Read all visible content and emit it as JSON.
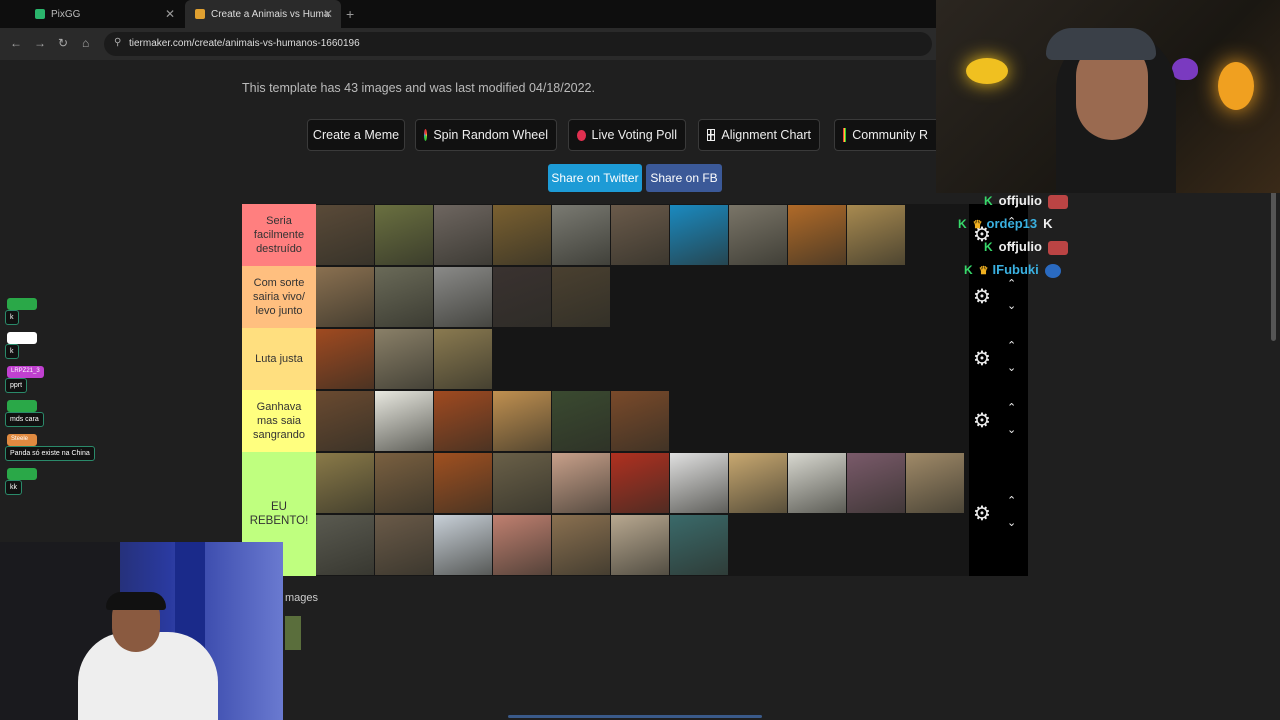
{
  "browser": {
    "tabs": [
      {
        "label": "PixGG",
        "favicon_color": "#2ab56c"
      },
      {
        "label": "Create a Animais vs Humanos T",
        "favicon_color": "#e0a030"
      }
    ],
    "new_tab": "+",
    "url": "tiermaker.com/create/animais-vs-humanos-1660196"
  },
  "page": {
    "template_info": "This template has 43 images and was last modified 04/18/2022.",
    "buttons": [
      {
        "label": "Create a Meme",
        "icon": ""
      },
      {
        "label": "Spin Random Wheel",
        "icon": "wheel-icon"
      },
      {
        "label": "Live Voting Poll",
        "icon": "record-icon"
      },
      {
        "label": "Alignment Chart",
        "icon": "grid-icon"
      },
      {
        "label": "Community R",
        "icon": "grid-colored-icon"
      }
    ],
    "share": {
      "twitter": "Share on Twitter",
      "fb": "Share on FB",
      "twitter_color": "#1d9bd6",
      "fb_color": "#3b5998"
    },
    "images_label": "mages"
  },
  "tiers": [
    {
      "label": "Seria facilmente destruído",
      "color": "#ff7f7f",
      "items": [
        {
          "name": "bear",
          "color": "#5a4a38"
        },
        {
          "name": "moose",
          "color": "#6a7040"
        },
        {
          "name": "hippo",
          "color": "#6e6660"
        },
        {
          "name": "jaguar",
          "color": "#7a6030"
        },
        {
          "name": "elephant",
          "color": "#7a7a72"
        },
        {
          "name": "rhino",
          "color": "#6a5a4a"
        },
        {
          "name": "shark",
          "color": "#1a8ac0"
        },
        {
          "name": "rhinoceros",
          "color": "#7a7568"
        },
        {
          "name": "tiger",
          "color": "#b06a28"
        },
        {
          "name": "lion",
          "color": "#a88a50"
        }
      ]
    },
    {
      "label": "Com sorte sairia vivo/ levo junto",
      "color": "#ffbf7f",
      "items": [
        {
          "name": "hyena",
          "color": "#8a7050"
        },
        {
          "name": "crocodile",
          "color": "#6a6a58"
        },
        {
          "name": "wolf",
          "color": "#8a8a88"
        },
        {
          "name": "chimpanzee",
          "color": "#3a3230"
        },
        {
          "name": "boar",
          "color": "#4a4030"
        }
      ]
    },
    {
      "label": "Luta justa",
      "color": "#ffdf7f",
      "items": [
        {
          "name": "orangutan",
          "color": "#a04a20"
        },
        {
          "name": "deer",
          "color": "#8a8068"
        },
        {
          "name": "cobra",
          "color": "#8a7a50"
        }
      ]
    },
    {
      "label": "Ganhava mas saia sangrando",
      "color": "#ffff7f",
      "items": [
        {
          "name": "dog",
          "color": "#6a4a30"
        },
        {
          "name": "eagle",
          "color": "#e8e8e0"
        },
        {
          "name": "maned wolf",
          "color": "#a04a20"
        },
        {
          "name": "cheetah",
          "color": "#c09050"
        },
        {
          "name": "tapir",
          "color": "#3a4a30"
        },
        {
          "name": "horse",
          "color": "#7a4a2a"
        }
      ]
    },
    {
      "label": "EU REBENTO!",
      "color": "#bfff7f",
      "items": [
        {
          "name": "kangaroo",
          "color": "#8a7a48"
        },
        {
          "name": "capybara",
          "color": "#7a6040"
        },
        {
          "name": "monkey",
          "color": "#a05020"
        },
        {
          "name": "ocelot",
          "color": "#6a6048"
        },
        {
          "name": "pig",
          "color": "#c8a08a"
        },
        {
          "name": "macaw",
          "color": "#b03020"
        },
        {
          "name": "penguin",
          "color": "#e0e0e0"
        },
        {
          "name": "ostrich",
          "color": "#c8a870"
        },
        {
          "name": "goose",
          "color": "#d8d8d0"
        },
        {
          "name": "dolphin",
          "color": "#7a5a6a"
        },
        {
          "name": "deer2",
          "color": "#a08a68"
        },
        {
          "name": "harpy eagle",
          "color": "#5a5a50"
        },
        {
          "name": "cat",
          "color": "#6a5a48"
        },
        {
          "name": "swan",
          "color": "#c8d0d8"
        },
        {
          "name": "piranha",
          "color": "#c08070"
        },
        {
          "name": "owl",
          "color": "#8a7050"
        },
        {
          "name": "zebra",
          "color": "#b8a890"
        },
        {
          "name": "peacock",
          "color": "#3a6a6a"
        }
      ]
    }
  ],
  "left_chat": [
    {
      "user": "",
      "msg": "k",
      "pill_color": "#2aa848"
    },
    {
      "user": "",
      "msg": "k",
      "pill_color": "#ffffff"
    },
    {
      "user": "LRPZ21_3",
      "msg": "pprt",
      "pill_color": "#c040d0"
    },
    {
      "user": "",
      "msg": "mds cara",
      "pill_color": "#2aa848"
    },
    {
      "user": "Steele",
      "msg": "Panda só existe na China",
      "pill_color": "#e08a40"
    },
    {
      "user": "",
      "msg": "kk",
      "pill_color": "#2aa848"
    }
  ],
  "right_chat": [
    {
      "user": "offjulio",
      "extra": ""
    },
    {
      "user": "ordep13",
      "extra": "K"
    },
    {
      "user": "offjulio",
      "extra": ""
    },
    {
      "user": "IFubuki",
      "extra": ""
    }
  ]
}
